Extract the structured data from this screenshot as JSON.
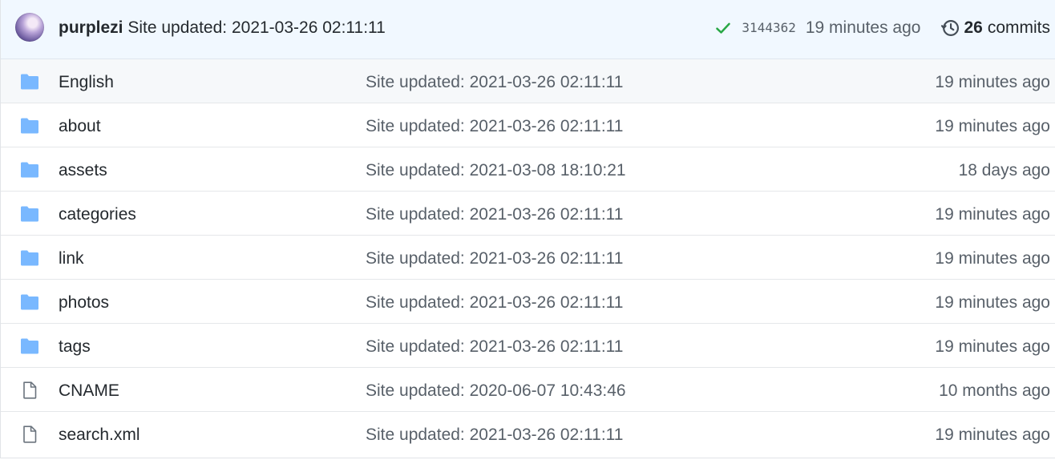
{
  "latest_commit": {
    "author": "purplezi",
    "message": "Site updated: 2021-03-26 02:11:11",
    "status_icon": "check-icon",
    "status_color": "#28a745",
    "sha": "3144362",
    "time": "19 minutes ago",
    "history_icon": "history-icon",
    "commits_count": "26",
    "commits_label": "commits"
  },
  "colors": {
    "folder": "#79b8ff",
    "file": "#6a737d",
    "header_bg": "#f1f8ff",
    "hover_row_bg": "#f6f8fa"
  },
  "files": [
    {
      "name": "English",
      "type": "folder",
      "icon": "folder-icon",
      "message": "Site updated: 2021-03-26 02:11:11",
      "age": "19 minutes ago"
    },
    {
      "name": "about",
      "type": "folder",
      "icon": "folder-icon",
      "message": "Site updated: 2021-03-26 02:11:11",
      "age": "19 minutes ago"
    },
    {
      "name": "assets",
      "type": "folder",
      "icon": "folder-icon",
      "message": "Site updated: 2021-03-08 18:10:21",
      "age": "18 days ago"
    },
    {
      "name": "categories",
      "type": "folder",
      "icon": "folder-icon",
      "message": "Site updated: 2021-03-26 02:11:11",
      "age": "19 minutes ago"
    },
    {
      "name": "link",
      "type": "folder",
      "icon": "folder-icon",
      "message": "Site updated: 2021-03-26 02:11:11",
      "age": "19 minutes ago"
    },
    {
      "name": "photos",
      "type": "folder",
      "icon": "folder-icon",
      "message": "Site updated: 2021-03-26 02:11:11",
      "age": "19 minutes ago"
    },
    {
      "name": "tags",
      "type": "folder",
      "icon": "folder-icon",
      "message": "Site updated: 2021-03-26 02:11:11",
      "age": "19 minutes ago"
    },
    {
      "name": "CNAME",
      "type": "file",
      "icon": "file-icon",
      "message": "Site updated: 2020-06-07 10:43:46",
      "age": "10 months ago"
    },
    {
      "name": "search.xml",
      "type": "file",
      "icon": "file-icon",
      "message": "Site updated: 2021-03-26 02:11:11",
      "age": "19 minutes ago"
    }
  ]
}
